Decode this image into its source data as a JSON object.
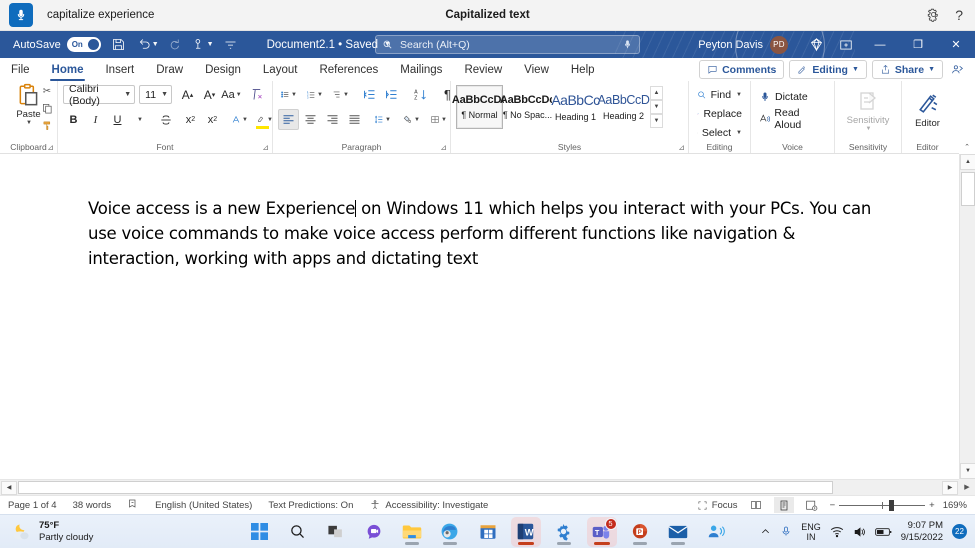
{
  "voice_access": {
    "mic_icon": "microphone-icon",
    "status_text": "capitalize experience",
    "center_title": "Capitalized text",
    "settings_icon": "gear-icon",
    "help_icon": "help-icon",
    "accent": "#0f6cbd"
  },
  "titlebar": {
    "autosave_label": "AutoSave",
    "autosave_state": "On",
    "save_icon": "save-icon",
    "undo_icon": "undo-icon",
    "redo_icon": "redo-icon",
    "touch_icon": "touch-mode-icon",
    "customize_icon": "customize-quick-access-icon",
    "doc_name": "Document2.1 • Saved",
    "doc_caret_icon": "chevron-down-icon",
    "search_placeholder": "Search (Alt+Q)",
    "search_icon": "search-icon",
    "search_mic_icon": "microphone-icon",
    "user_name": "Peyton Davis",
    "user_initials": "PD",
    "user_avatar_color": "#8a5541",
    "diamond_icon": "office-premium-icon",
    "ribbon_display_icon": "ribbon-display-options-icon",
    "minimize": "—",
    "restore": "❐",
    "close": "✕",
    "bg": "#2b579a"
  },
  "tabs": {
    "items": [
      {
        "label": "File",
        "active": false
      },
      {
        "label": "Home",
        "active": true
      },
      {
        "label": "Insert",
        "active": false
      },
      {
        "label": "Draw",
        "active": false
      },
      {
        "label": "Design",
        "active": false
      },
      {
        "label": "Layout",
        "active": false
      },
      {
        "label": "References",
        "active": false
      },
      {
        "label": "Mailings",
        "active": false
      },
      {
        "label": "Review",
        "active": false
      },
      {
        "label": "View",
        "active": false
      },
      {
        "label": "Help",
        "active": false
      }
    ],
    "comments_label": "Comments",
    "editing_label": "Editing",
    "share_label": "Share",
    "comments_icon": "comment-icon",
    "editing_icon": "pencil-icon",
    "share_icon": "share-icon",
    "collab_icon": "people-icon"
  },
  "ribbon": {
    "clipboard": {
      "group_label": "Clipboard",
      "paste_label": "Paste",
      "paste_icon": "paste-icon",
      "cut_icon": "scissors-icon",
      "copy_icon": "copy-icon",
      "format_painter_icon": "format-painter-icon",
      "launcher_icon": "dialog-launcher-icon"
    },
    "font": {
      "group_label": "Font",
      "font_name": "Calibri (Body)",
      "font_size": "11",
      "grow_font_icon": "grow-font-icon",
      "shrink_font_icon": "shrink-font-icon",
      "change_case_label": "Aa",
      "clear_formatting_icon": "clear-formatting-icon",
      "bold_label": "B",
      "italic_label": "I",
      "underline_label": "U",
      "strikethrough_icon": "strikethrough-icon",
      "subscript_label": "x",
      "superscript_label": "x",
      "text_effects_icon": "text-effects-icon",
      "highlight_icon": "text-highlight-icon",
      "font_color_icon": "font-color-icon",
      "highlight_color": "#ffe600",
      "font_color": "#c00000",
      "launcher_icon": "dialog-launcher-icon"
    },
    "paragraph": {
      "group_label": "Paragraph",
      "bullets_icon": "bullets-icon",
      "numbering_icon": "numbering-icon",
      "multilevel_icon": "multilevel-list-icon",
      "decrease_indent_icon": "decrease-indent-icon",
      "increase_indent_icon": "increase-indent-icon",
      "sort_icon": "sort-icon",
      "show_marks_icon": "paragraph-marks-icon",
      "align_left_icon": "align-left-icon",
      "align_center_icon": "align-center-icon",
      "align_right_icon": "align-right-icon",
      "justify_icon": "justify-icon",
      "line_spacing_icon": "line-spacing-icon",
      "shading_icon": "shading-icon",
      "borders_icon": "borders-icon",
      "launcher_icon": "dialog-launcher-icon"
    },
    "styles": {
      "group_label": "Styles",
      "items": [
        {
          "preview": "AaBbCcDc",
          "name": "¶ Normal",
          "kind": "normal",
          "selected": true
        },
        {
          "preview": "AaBbCcDc",
          "name": "¶ No Spac...",
          "kind": "normal",
          "selected": false
        },
        {
          "preview": "AaBbCc",
          "name": "Heading 1",
          "kind": "h1",
          "selected": false
        },
        {
          "preview": "AaBbCcD",
          "name": "Heading 2",
          "kind": "h2",
          "selected": false
        }
      ],
      "scroll_up_icon": "scroll-up-icon",
      "scroll_down_icon": "scroll-down-icon",
      "more_icon": "more-styles-icon",
      "launcher_icon": "dialog-launcher-icon"
    },
    "editing": {
      "group_label": "Editing",
      "find_label": "Find",
      "replace_label": "Replace",
      "select_label": "Select",
      "find_icon": "find-icon",
      "replace_icon": "replace-icon",
      "select_icon": "select-icon"
    },
    "voice": {
      "group_label": "Voice",
      "dictate_label": "Dictate",
      "read_aloud_label": "Read Aloud",
      "dictate_icon": "microphone-icon",
      "read_aloud_icon": "read-aloud-icon"
    },
    "sensitivity": {
      "group_label": "Sensitivity",
      "button_label": "Sensitivity",
      "icon": "sensitivity-icon"
    },
    "editor": {
      "group_label": "Editor",
      "button_label": "Editor",
      "icon": "editor-icon"
    },
    "collapse_icon": "collapse-ribbon-icon"
  },
  "document": {
    "paragraph_before_caret": "Voice access is a new Experience",
    "paragraph_after_caret": " on Windows 11 which helps you interact with your PCs. You can use voice commands to make voice access perform different functions like navigation & interaction, working with apps and dictating text"
  },
  "scrollbars": {
    "v_up_icon": "scroll-up-icon",
    "v_down_icon": "scroll-down-icon",
    "h_left_icon": "scroll-left-icon",
    "h_right_icon": "scroll-right-icon",
    "split_icon": "split-window-icon"
  },
  "status_bar": {
    "page": "Page 1 of 4",
    "words": "38 words",
    "proofing_icon": "proofing-icon",
    "language": "English (United States)",
    "text_predictions": "Text Predictions: On",
    "accessibility_icon": "accessibility-icon",
    "accessibility": "Accessibility: Investigate",
    "focus_label": "Focus",
    "focus_icon": "focus-icon",
    "read_mode_icon": "read-mode-icon",
    "print_layout_icon": "print-layout-icon",
    "web_layout_icon": "web-layout-icon",
    "zoom_out": "−",
    "zoom_in": "+",
    "zoom_level": "169%"
  },
  "taskbar": {
    "weather_temp": "75°F",
    "weather_desc": "Partly cloudy",
    "weather_icon": "partly-cloudy-night-icon",
    "apps": [
      {
        "name": "start-button",
        "icon": "windows-logo-icon",
        "active": false,
        "running": false,
        "badge": ""
      },
      {
        "name": "search-button",
        "icon": "search-icon",
        "active": false,
        "running": false,
        "badge": ""
      },
      {
        "name": "task-view-button",
        "icon": "task-view-icon",
        "active": false,
        "running": false,
        "badge": ""
      },
      {
        "name": "chat-button",
        "icon": "chat-icon",
        "active": false,
        "running": false,
        "badge": ""
      },
      {
        "name": "file-explorer-button",
        "icon": "folder-icon",
        "active": false,
        "running": true,
        "badge": ""
      },
      {
        "name": "edge-button",
        "icon": "edge-icon",
        "active": false,
        "running": true,
        "badge": ""
      },
      {
        "name": "microsoft-store-button",
        "icon": "store-icon",
        "active": false,
        "running": false,
        "badge": ""
      },
      {
        "name": "word-button",
        "icon": "word-icon",
        "active": true,
        "running": true,
        "badge": ""
      },
      {
        "name": "settings-button",
        "icon": "gear-icon",
        "active": false,
        "running": true,
        "badge": ""
      },
      {
        "name": "teams-button",
        "icon": "teams-icon",
        "active": false,
        "running": true,
        "badge": "5"
      },
      {
        "name": "powerpoint-button",
        "icon": "powerpoint-icon",
        "active": false,
        "running": true,
        "badge": ""
      },
      {
        "name": "mail-button",
        "icon": "mail-icon",
        "active": false,
        "running": true,
        "badge": ""
      },
      {
        "name": "voice-access-button",
        "icon": "voice-access-icon",
        "active": false,
        "running": false,
        "badge": ""
      }
    ],
    "tray_expand_icon": "chevron-up-icon",
    "tray_mic_icon": "microphone-icon",
    "language_line1": "ENG",
    "language_line2": "IN",
    "wifi_icon": "wifi-icon",
    "volume_icon": "speaker-icon",
    "battery_icon": "battery-icon",
    "time": "9:07 PM",
    "date": "9/15/2022",
    "notification_count": "22"
  }
}
